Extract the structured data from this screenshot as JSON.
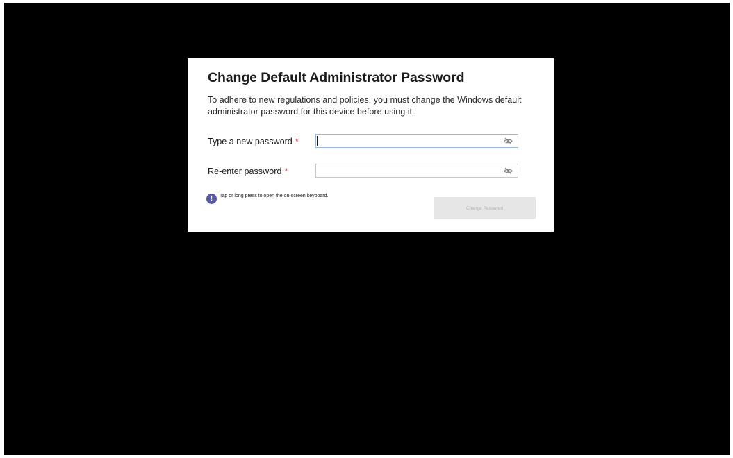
{
  "dialog": {
    "title": "Change Default Administrator Password",
    "description": "To adhere to new regulations and policies, you must change the Windows default administrator password for this device before using it.",
    "new_password": {
      "label": "Type a new password",
      "required_marker": "*",
      "value": "",
      "reveal_icon": "eye-slash-icon"
    },
    "reenter_password": {
      "label": "Re-enter password",
      "required_marker": "*",
      "value": "",
      "reveal_icon": "eye-slash-icon"
    },
    "hint": {
      "icon": "exclamation-circle-icon",
      "icon_glyph": "!",
      "text": "Tap or long press to open the on-screen keyboard."
    },
    "submit_label": "Change Password"
  },
  "colors": {
    "background": "#000000",
    "dialog": "#ffffff",
    "required": "#d13438",
    "hint_icon": "#5c58a8",
    "button_disabled_bg": "#e6e6e6",
    "button_disabled_text": "#b0b0b0",
    "focus_border": "#9ab8d8"
  }
}
